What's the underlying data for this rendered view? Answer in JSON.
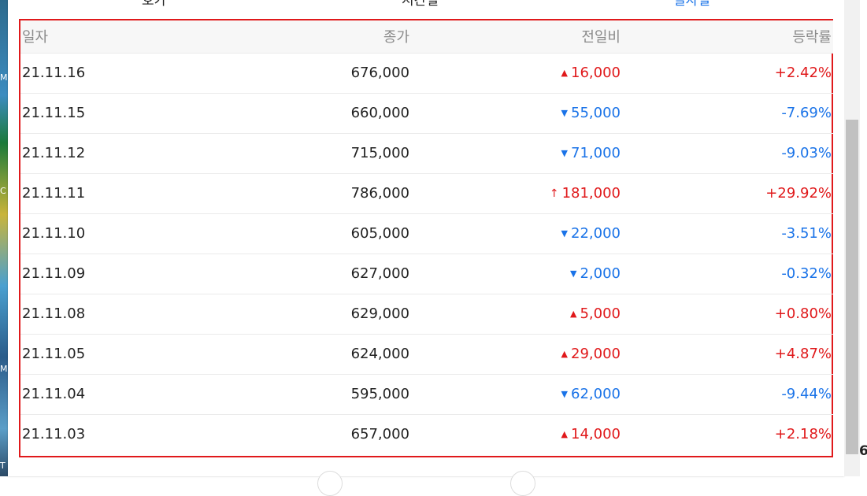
{
  "tabs": [
    "호가",
    "시간별",
    "일자별"
  ],
  "columns": {
    "date": "일자",
    "close": "종가",
    "change": "전일비",
    "rate": "등락률"
  },
  "rows": [
    {
      "date": "21.11.16",
      "close": "676,000",
      "change": "16,000",
      "direction": "up",
      "rate": "+2.42%"
    },
    {
      "date": "21.11.15",
      "close": "660,000",
      "change": "55,000",
      "direction": "down",
      "rate": "-7.69%"
    },
    {
      "date": "21.11.12",
      "close": "715,000",
      "change": "71,000",
      "direction": "down",
      "rate": "-9.03%"
    },
    {
      "date": "21.11.11",
      "close": "786,000",
      "change": "181,000",
      "direction": "limit-up",
      "rate": "+29.92%"
    },
    {
      "date": "21.11.10",
      "close": "605,000",
      "change": "22,000",
      "direction": "down",
      "rate": "-3.51%"
    },
    {
      "date": "21.11.09",
      "close": "627,000",
      "change": "2,000",
      "direction": "down",
      "rate": "-0.32%"
    },
    {
      "date": "21.11.08",
      "close": "629,000",
      "change": "5,000",
      "direction": "up",
      "rate": "+0.80%"
    },
    {
      "date": "21.11.05",
      "close": "624,000",
      "change": "29,000",
      "direction": "up",
      "rate": "+4.87%"
    },
    {
      "date": "21.11.04",
      "close": "595,000",
      "change": "62,000",
      "direction": "down",
      "rate": "-9.44%"
    },
    {
      "date": "21.11.03",
      "close": "657,000",
      "change": "14,000",
      "direction": "up",
      "rate": "+2.18%"
    }
  ],
  "icons": {
    "up": "triangle-up-icon",
    "down": "triangle-down-icon",
    "limit-up": "arrow-up-icon"
  },
  "colors": {
    "up": "#e0191b",
    "down": "#1a73e8",
    "highlight_border": "#e0191b"
  },
  "desktop_edge": {
    "glyphs": [
      "M",
      "C",
      "M",
      "T"
    ],
    "right_text": "6"
  }
}
